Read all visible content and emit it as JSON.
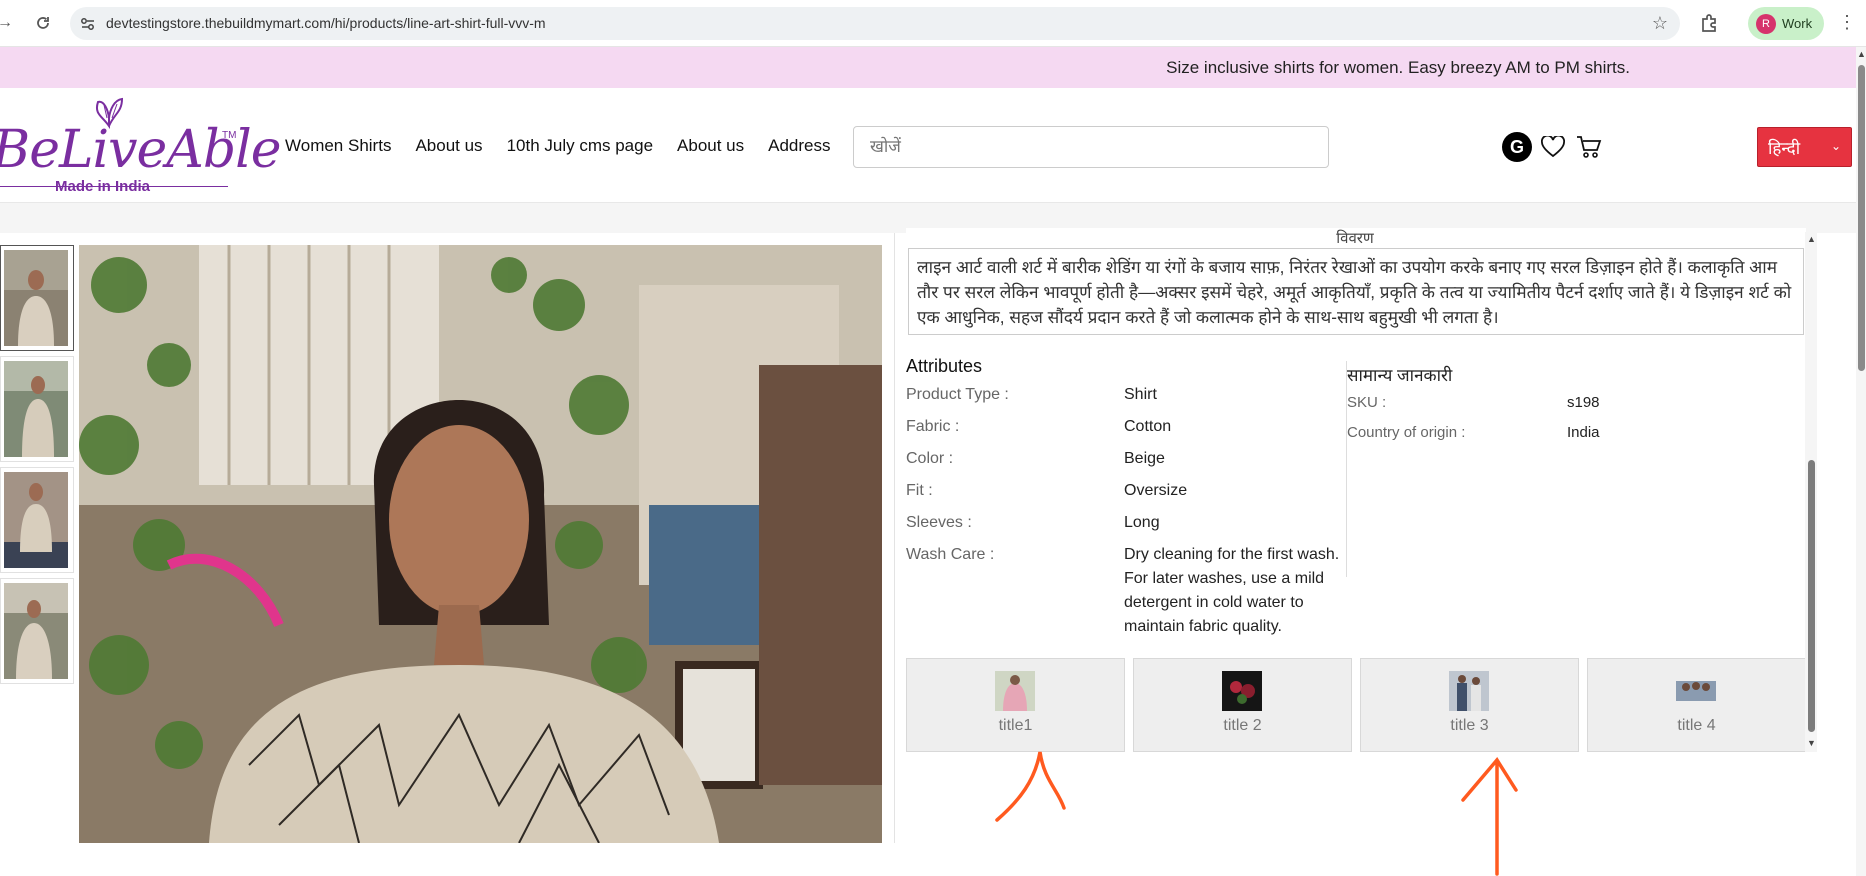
{
  "browser": {
    "url": "devtestingstore.thebuildmymart.com/hi/products/line-art-shirt-full-vvv-m",
    "profile_initial": "R",
    "profile_label": "Work"
  },
  "announcement": "Size inclusive shirts for women. Easy breezy AM to PM shirts.",
  "logo": {
    "brand": "BeLiveAble",
    "tm": "TM",
    "tagline": "Made in India"
  },
  "nav": [
    "Women Shirts",
    "About us",
    "10th July cms page",
    "About us",
    "Address"
  ],
  "search": {
    "placeholder": "खोजें"
  },
  "header_icons": {
    "account_letter": "G"
  },
  "language": {
    "selected": "हिन्दी"
  },
  "product": {
    "description_heading": "विवरण",
    "description": "लाइन आर्ट वाली शर्ट में बारीक शेडिंग या रंगों के बजाय साफ़, निरंतर रेखाओं का उपयोग करके बनाए गए सरल डिज़ाइन होते हैं। कलाकृति आम तौर पर सरल लेकिन भावपूर्ण होती है—अक्सर इसमें चेहरे, अमूर्त आकृतियाँ, प्रकृति के तत्व या ज्यामितीय पैटर्न दर्शाए जाते हैं। ये डिज़ाइन शर्ट को एक आधुनिक, सहज सौंदर्य प्रदान करते हैं जो कलात्मक होने के साथ-साथ बहुमुखी भी लगता है।",
    "attributes_title": "Attributes",
    "attributes": [
      {
        "key": "Product Type :",
        "value": "Shirt"
      },
      {
        "key": "Fabric :",
        "value": "Cotton"
      },
      {
        "key": "Color :",
        "value": "Beige"
      },
      {
        "key": "Fit :",
        "value": "Oversize"
      },
      {
        "key": "Sleeves :",
        "value": "Long"
      },
      {
        "key": "Wash Care :",
        "value": "Dry cleaning for the first wash. For later washes, use a mild detergent in cold water to maintain fabric quality."
      }
    ],
    "general_title": "सामान्य जानकारी",
    "general": [
      {
        "key": "SKU :",
        "value": "s198"
      },
      {
        "key": "Country of origin :",
        "value": "India"
      }
    ],
    "cards": [
      {
        "label": "title1"
      },
      {
        "label": "title 2"
      },
      {
        "label": "title 3"
      },
      {
        "label": "title 4"
      }
    ]
  },
  "colors": {
    "announcement_bg": "#f5d9f2",
    "brand_purple": "#7a2ea0",
    "language_bg": "#e63340",
    "annotation_arrow": "#ff5a1f"
  }
}
